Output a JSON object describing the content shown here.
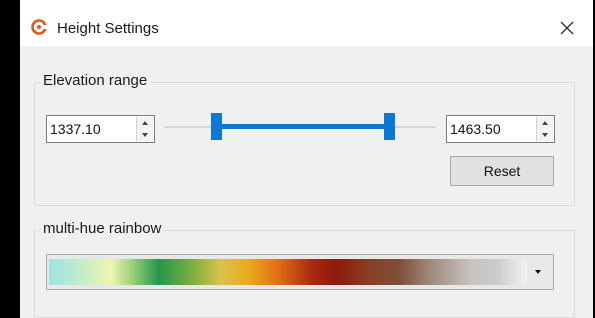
{
  "window": {
    "title": "Height Settings",
    "app_icon": "app-logo-icon",
    "close_icon": "close-icon"
  },
  "elevation_range": {
    "group_title": "Elevation range",
    "min_value": "1337.10",
    "max_value": "1463.50",
    "reset_label": "Reset",
    "spin_icons": [
      "spin-up-icon",
      "spin-down-icon"
    ]
  },
  "colormap": {
    "group_title": "multi-hue rainbow",
    "selected_label": "multi-hue rainbow",
    "dropdown_icon": "chevron-down-icon",
    "accent_color": "#0a78d7"
  }
}
